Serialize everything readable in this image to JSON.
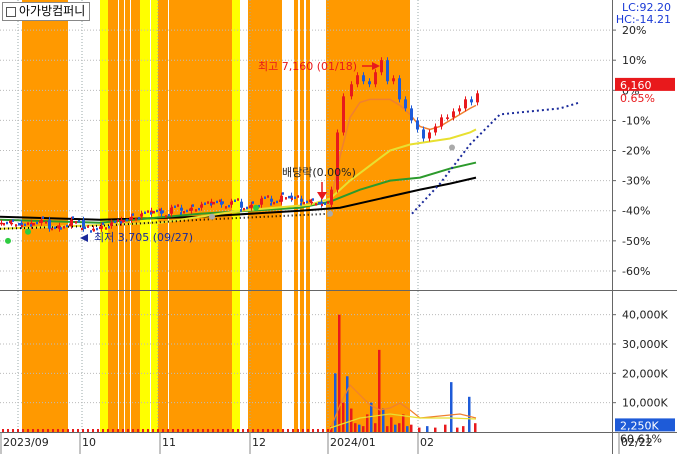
{
  "header": {
    "title": "아가방컴퍼니"
  },
  "indicators": {
    "lc": "LC:92.20",
    "hc": "HC:-14.21"
  },
  "price_panel": {
    "y_ticks": [
      "20%",
      "10%",
      "0%",
      "-10%",
      "-20%",
      "-30%",
      "-40%",
      "-50%",
      "-60%"
    ],
    "y_tick_values": [
      20,
      10,
      0,
      -10,
      -20,
      -30,
      -40,
      -50,
      -60
    ],
    "current_price": "6,160",
    "current_change": "0.65%",
    "high_annotation": "최고 7,160 (01/18)",
    "low_annotation": "최저 3,705 (09/27)",
    "dividend_annotation": "배당락(0.00%)"
  },
  "volume_panel": {
    "y_ticks": [
      "40,000K",
      "30,000K",
      "20,000K",
      "10,000K"
    ],
    "y_tick_values": [
      40000,
      30000,
      20000,
      10000
    ],
    "current_volume": "2,250K",
    "current_ratio": "60.61%"
  },
  "x_axis": {
    "labels": [
      "2023/09",
      "10",
      "11",
      "12",
      "2024/01",
      "02",
      "02/22"
    ]
  },
  "colors": {
    "orange_zone": "#FF9900",
    "yellow_zone": "#FFFF00",
    "candle_up": "#E8191C",
    "candle_down": "#1E5BD8",
    "ma5": "#F08030",
    "ma20": "#E8E030",
    "ma60": "#2C9A2C",
    "ma120": "#000000",
    "axis_text": "#222222",
    "up_text": "#E8191C",
    "lchc_text": "#1A3AD6"
  },
  "chart_data": {
    "type": "candlestick",
    "y_unit": "% change",
    "ylim": [
      -66,
      30
    ],
    "volume_ylim": [
      0,
      45000
    ],
    "high": 7160,
    "low": 3705,
    "last_price": 6160,
    "last_change_pct": 0.65,
    "last_volume_k": 2250,
    "price_path": [
      [
        0,
        -44
      ],
      [
        10,
        -44
      ],
      [
        20,
        -45
      ],
      [
        30,
        -44
      ],
      [
        40,
        -43
      ],
      [
        48,
        -46
      ],
      [
        58,
        -45
      ],
      [
        70,
        -43
      ],
      [
        82,
        -46
      ],
      [
        92,
        -46
      ],
      [
        100,
        -45
      ],
      [
        110,
        -44
      ],
      [
        120,
        -43
      ],
      [
        130,
        -42
      ],
      [
        140,
        -41
      ],
      [
        150,
        -40
      ],
      [
        160,
        -41
      ],
      [
        170,
        -39
      ],
      [
        180,
        -40
      ],
      [
        190,
        -39
      ],
      [
        200,
        -38
      ],
      [
        210,
        -37
      ],
      [
        220,
        -38
      ],
      [
        230,
        -37
      ],
      [
        240,
        -39
      ],
      [
        250,
        -38
      ],
      [
        260,
        -36
      ],
      [
        270,
        -37
      ],
      [
        280,
        -35
      ],
      [
        290,
        -36
      ],
      [
        300,
        -37
      ],
      [
        310,
        -37
      ],
      [
        320,
        -38
      ],
      [
        330,
        -33
      ],
      [
        336,
        -14
      ],
      [
        342,
        -2
      ],
      [
        350,
        2
      ],
      [
        356,
        5
      ],
      [
        362,
        3
      ],
      [
        368,
        2
      ],
      [
        374,
        6
      ],
      [
        380,
        10
      ],
      [
        386,
        3
      ],
      [
        392,
        4
      ],
      [
        398,
        -3
      ],
      [
        404,
        -6
      ],
      [
        410,
        -10
      ],
      [
        416,
        -13
      ],
      [
        422,
        -16
      ],
      [
        428,
        -14
      ],
      [
        434,
        -12
      ],
      [
        440,
        -9
      ],
      [
        446,
        -9
      ],
      [
        452,
        -7
      ],
      [
        458,
        -6
      ],
      [
        464,
        -3
      ],
      [
        470,
        -4
      ],
      [
        476,
        -1
      ]
    ],
    "ma5": [
      [
        330,
        -38
      ],
      [
        340,
        -22
      ],
      [
        350,
        -9
      ],
      [
        360,
        -4
      ],
      [
        370,
        -3
      ],
      [
        380,
        -3
      ],
      [
        390,
        -3
      ],
      [
        400,
        -5
      ],
      [
        410,
        -8
      ],
      [
        420,
        -12
      ],
      [
        430,
        -13
      ],
      [
        440,
        -12
      ],
      [
        450,
        -10
      ],
      [
        460,
        -8
      ],
      [
        470,
        -6
      ],
      [
        476,
        -5
      ]
    ],
    "ma20": [
      [
        0,
        -46
      ],
      [
        80,
        -45
      ],
      [
        160,
        -44
      ],
      [
        240,
        -40
      ],
      [
        310,
        -38
      ],
      [
        330,
        -36
      ],
      [
        350,
        -30
      ],
      [
        370,
        -25
      ],
      [
        390,
        -20
      ],
      [
        410,
        -18
      ],
      [
        430,
        -17
      ],
      [
        450,
        -16
      ],
      [
        470,
        -14
      ],
      [
        476,
        -13
      ]
    ],
    "ma60": [
      [
        0,
        -43
      ],
      [
        100,
        -44
      ],
      [
        200,
        -41
      ],
      [
        300,
        -39
      ],
      [
        330,
        -37
      ],
      [
        360,
        -33
      ],
      [
        390,
        -30
      ],
      [
        420,
        -29
      ],
      [
        450,
        -26
      ],
      [
        476,
        -24
      ]
    ],
    "ma120": [
      [
        0,
        -42
      ],
      [
        100,
        -43
      ],
      [
        200,
        -42
      ],
      [
        300,
        -40
      ],
      [
        340,
        -39
      ],
      [
        380,
        -36
      ],
      [
        420,
        -33
      ],
      [
        450,
        -31
      ],
      [
        476,
        -29
      ]
    ],
    "forecast": [
      [
        412,
        -41
      ],
      [
        440,
        -31
      ],
      [
        470,
        -18
      ],
      [
        500,
        -8
      ],
      [
        530,
        -7
      ],
      [
        560,
        -6
      ],
      [
        580,
        -4
      ]
    ],
    "volume_bars": [
      [
        330,
        2000
      ],
      [
        334,
        20000
      ],
      [
        338,
        40000
      ],
      [
        342,
        10000
      ],
      [
        346,
        19000
      ],
      [
        350,
        8000
      ],
      [
        354,
        3000
      ],
      [
        358,
        2500
      ],
      [
        362,
        2000
      ],
      [
        366,
        6000
      ],
      [
        370,
        10000
      ],
      [
        374,
        3000
      ],
      [
        378,
        28000
      ],
      [
        382,
        8000
      ],
      [
        386,
        2000
      ],
      [
        390,
        5000
      ],
      [
        394,
        2500
      ],
      [
        398,
        3000
      ],
      [
        402,
        6000
      ],
      [
        406,
        2000
      ],
      [
        410,
        2500
      ],
      [
        418,
        1500
      ],
      [
        426,
        2000
      ],
      [
        434,
        1500
      ],
      [
        444,
        2500
      ],
      [
        450,
        17000
      ],
      [
        456,
        1500
      ],
      [
        462,
        2000
      ],
      [
        468,
        12000
      ],
      [
        474,
        3000
      ]
    ],
    "zones": [
      {
        "color": "orange",
        "x": [
          22,
          68
        ]
      },
      {
        "color": "yellow",
        "x": [
          100,
          108
        ]
      },
      {
        "color": "orange",
        "x": [
          108,
          140
        ]
      },
      {
        "color": "yellow",
        "x": [
          140,
          158
        ]
      },
      {
        "color": "orange",
        "x": [
          158,
          232
        ]
      },
      {
        "color": "yellow",
        "x": [
          232,
          240
        ]
      },
      {
        "color": "orange",
        "x": [
          248,
          282
        ]
      },
      {
        "color": "orange",
        "x": [
          294,
          298
        ]
      },
      {
        "color": "orange",
        "x": [
          300,
          304
        ]
      },
      {
        "color": "orange",
        "x": [
          306,
          310
        ]
      },
      {
        "color": "orange",
        "x": [
          326,
          410
        ]
      }
    ]
  }
}
